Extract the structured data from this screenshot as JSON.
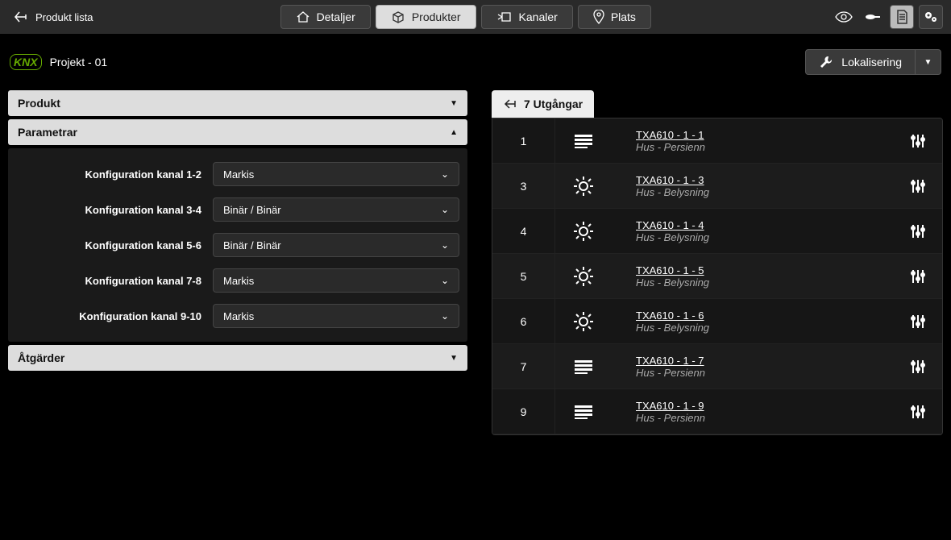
{
  "topbar": {
    "back": "Produkt lista",
    "nav": {
      "details": "Detaljer",
      "products": "Produkter",
      "channels": "Kanaler",
      "place": "Plats"
    }
  },
  "subheader": {
    "logo": "KNX",
    "project": "Projekt - 01",
    "localization": "Lokalisering"
  },
  "accordion": {
    "product": "Produkt",
    "parameters": "Parametrar",
    "actions": "Åtgärder"
  },
  "params": [
    {
      "label": "Konfiguration kanal 1-2",
      "value": "Markis"
    },
    {
      "label": "Konfiguration kanal 3-4",
      "value": "Binär / Binär"
    },
    {
      "label": "Konfiguration kanal 5-6",
      "value": "Binär / Binär"
    },
    {
      "label": "Konfiguration kanal 7-8",
      "value": "Markis"
    },
    {
      "label": "Konfiguration kanal 9-10",
      "value": "Markis"
    }
  ],
  "outputs": {
    "header": "7 Utgångar",
    "rows": [
      {
        "num": "1",
        "type": "shutter",
        "name": "TXA610 - 1 - 1",
        "loc": "Hus - Persienn"
      },
      {
        "num": "3",
        "type": "light",
        "name": "TXA610 - 1 - 3",
        "loc": "Hus - Belysning"
      },
      {
        "num": "4",
        "type": "light",
        "name": "TXA610 - 1 - 4",
        "loc": "Hus - Belysning"
      },
      {
        "num": "5",
        "type": "light",
        "name": "TXA610 - 1 - 5",
        "loc": "Hus - Belysning"
      },
      {
        "num": "6",
        "type": "light",
        "name": "TXA610 - 1 - 6",
        "loc": "Hus - Belysning"
      },
      {
        "num": "7",
        "type": "shutter",
        "name": "TXA610 - 1 - 7",
        "loc": "Hus - Persienn"
      },
      {
        "num": "9",
        "type": "shutter",
        "name": "TXA610 - 1 - 9",
        "loc": "Hus - Persienn"
      }
    ]
  }
}
